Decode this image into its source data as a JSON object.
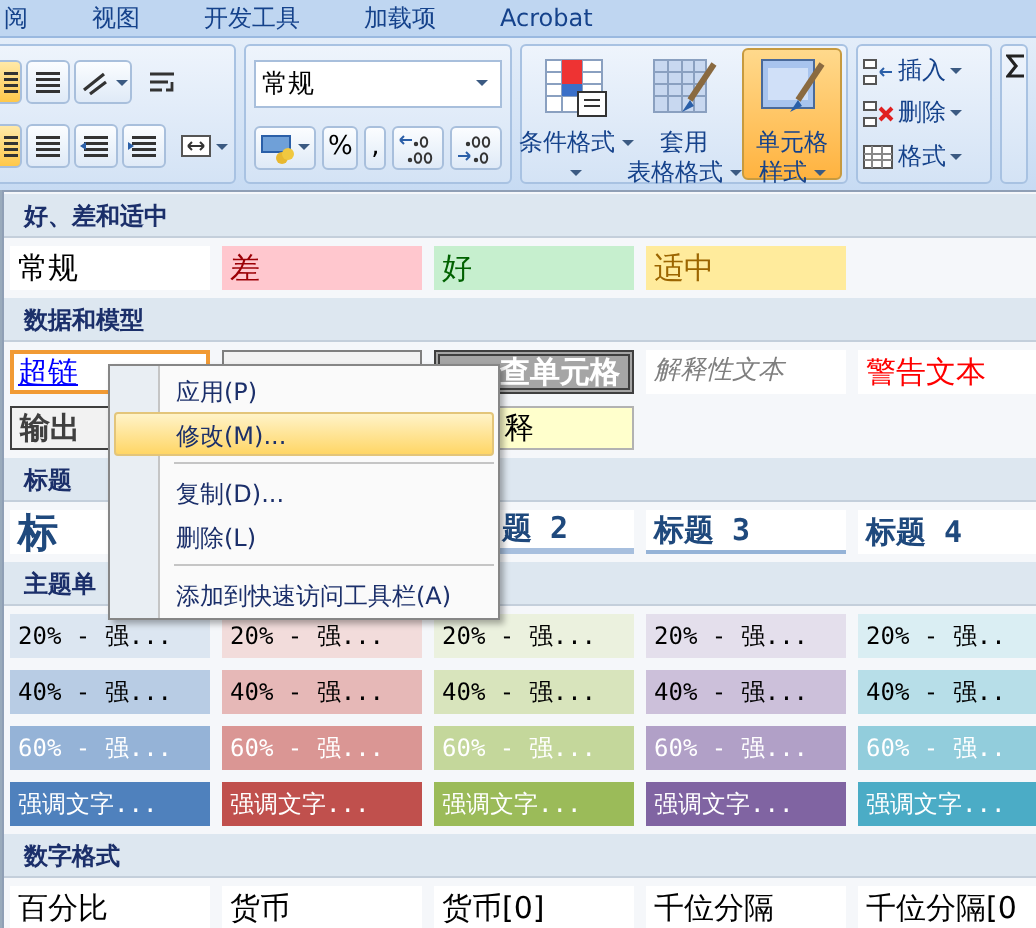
{
  "tabs": [
    {
      "label": "阅",
      "selected": false
    },
    {
      "label": "视图",
      "selected": false
    },
    {
      "label": "开发工具",
      "selected": false
    },
    {
      "label": "加载项",
      "selected": false
    },
    {
      "label": "Acrobat",
      "selected": false
    }
  ],
  "ribbon": {
    "number_format": {
      "value": "常规"
    },
    "number_buttons": [
      {
        "label": "%"
      },
      {
        "label": ","
      }
    ],
    "style_buttons": [
      {
        "lines": [
          "条件格式"
        ],
        "kind": "conditional",
        "pressed": false
      },
      {
        "lines": [
          "套用",
          "表格格式"
        ],
        "kind": "table",
        "pressed": false
      },
      {
        "lines": [
          "单元格",
          "样式"
        ],
        "kind": "cellstyle",
        "pressed": true
      }
    ],
    "cell_buttons": [
      {
        "label": "插入",
        "kind": "insert"
      },
      {
        "label": "删除",
        "kind": "delete"
      },
      {
        "label": "格式",
        "kind": "format"
      }
    ]
  },
  "gallery": {
    "sections": [
      {
        "title": "好、差和适中",
        "rows": [
          [
            {
              "text": "常规",
              "kind": "normal",
              "selected": false
            },
            {
              "text": "差",
              "kind": "bad",
              "selected": false
            },
            {
              "text": "好",
              "kind": "good",
              "selected": false
            },
            {
              "text": "适中",
              "kind": "neutral",
              "selected": false
            }
          ]
        ]
      },
      {
        "title": "数据和模型",
        "rows": [
          [
            {
              "text": "超链",
              "kind": "hyperlink",
              "selected": true
            },
            {
              "kind": "calc",
              "selected": false
            },
            {
              "text": "查单元格",
              "kind": "check",
              "selected": false
            },
            {
              "text": "解释性文本",
              "kind": "explain",
              "selected": false
            },
            {
              "text": "警告文本",
              "kind": "warn",
              "selected": false
            }
          ],
          [
            {
              "text": "输出",
              "kind": "output",
              "selected": false
            },
            {
              "text": "释",
              "kind": "note",
              "selected": false
            }
          ]
        ]
      },
      {
        "title": "标题",
        "rows": [
          [
            {
              "text": "标",
              "kind": "title",
              "selected": false
            },
            {
              "text": "题 2",
              "kind": "heading2",
              "selected": false
            },
            {
              "text": "标题 3",
              "kind": "heading3",
              "selected": false
            },
            {
              "text": "标题 4",
              "kind": "heading4",
              "selected": false
            }
          ]
        ]
      },
      {
        "title": "主题单",
        "rows": [
          [
            {
              "text": "20% - 强...",
              "kind": "theme-light",
              "color": "#dce6f1",
              "selected": false
            },
            {
              "text": "20% - 强...",
              "kind": "theme-light",
              "color": "#f2dcdb",
              "selected": false
            },
            {
              "text": "20% - 强...",
              "kind": "theme-light",
              "color": "#ebf1de",
              "selected": false
            },
            {
              "text": "20% - 强...",
              "kind": "theme-light",
              "color": "#e4dfec",
              "selected": false
            },
            {
              "text": "20% - 强..",
              "kind": "theme-light",
              "color": "#daeef3",
              "selected": false
            }
          ],
          [
            {
              "text": "40% - 强...",
              "kind": "theme-light",
              "color": "#b8cce4",
              "selected": false
            },
            {
              "text": "40% - 强...",
              "kind": "theme-light",
              "color": "#e6b8b7",
              "selected": false
            },
            {
              "text": "40% - 强...",
              "kind": "theme-light",
              "color": "#d8e4bc",
              "selected": false
            },
            {
              "text": "40% - 强...",
              "kind": "theme-light",
              "color": "#ccc0da",
              "selected": false
            },
            {
              "text": "40% - 强..",
              "kind": "theme-light",
              "color": "#b7dee8",
              "selected": false
            }
          ],
          [
            {
              "text": "60% - 强...",
              "kind": "theme-dark",
              "color": "#95b3d7",
              "selected": false
            },
            {
              "text": "60% - 强...",
              "kind": "theme-dark",
              "color": "#da9694",
              "selected": false
            },
            {
              "text": "60% - 强...",
              "kind": "theme-dark",
              "color": "#c4d79b",
              "selected": false
            },
            {
              "text": "60% - 强...",
              "kind": "theme-dark",
              "color": "#b1a0c7",
              "selected": false
            },
            {
              "text": "60% - 强..",
              "kind": "theme-dark",
              "color": "#92cddc",
              "selected": false
            }
          ],
          [
            {
              "text": "强调文字...",
              "kind": "theme-dark",
              "color": "#4f81bd",
              "selected": false
            },
            {
              "text": "强调文字...",
              "kind": "theme-dark",
              "color": "#c0504d",
              "selected": false
            },
            {
              "text": "强调文字...",
              "kind": "theme-dark",
              "color": "#9bbb59",
              "selected": false
            },
            {
              "text": "强调文字...",
              "kind": "theme-dark",
              "color": "#8064a2",
              "selected": false
            },
            {
              "text": "强调文字...",
              "kind": "theme-dark",
              "color": "#4bacc6",
              "selected": false
            }
          ]
        ]
      },
      {
        "title": "数字格式",
        "rows": [
          [
            {
              "text": "百分比",
              "kind": "normal",
              "selected": false
            },
            {
              "text": "货币",
              "kind": "normal",
              "selected": false
            },
            {
              "text": "货币[0]",
              "kind": "normal",
              "selected": false
            },
            {
              "text": "千位分隔",
              "kind": "normal",
              "selected": false
            },
            {
              "text": "千位分隔[0",
              "kind": "normal",
              "selected": false
            }
          ]
        ]
      }
    ]
  },
  "context_menu": [
    {
      "label": "应用(P)",
      "selected": false,
      "separator_after": false
    },
    {
      "label": "修改(M)...",
      "selected": true,
      "separator_after": true
    },
    {
      "label": "复制(D)...",
      "selected": false,
      "separator_after": false
    },
    {
      "label": "删除(L)",
      "selected": false,
      "separator_after": true
    },
    {
      "label": "添加到快速访问工具栏(A)",
      "selected": false,
      "separator_after": false
    }
  ]
}
